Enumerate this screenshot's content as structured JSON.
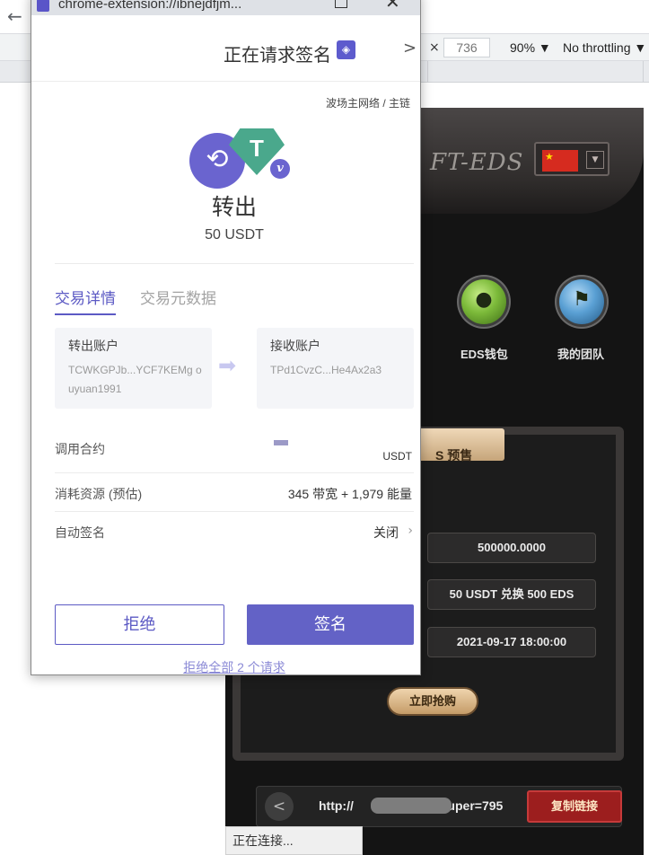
{
  "browser": {
    "back_glyph": "←",
    "devtools": {
      "close_glyph": "×",
      "height_value": "736",
      "zoom": "90% ▼",
      "throttling": "No throttling ▼"
    }
  },
  "popup": {
    "url": "chrome-extension://ibnejdfjm...",
    "restore_glyph": "",
    "close_glyph": "✕",
    "header": {
      "title": "正在请求签名",
      "logo_glyph": "◈",
      "chevron": ">"
    },
    "network": "波场主网络 / 主链",
    "transaction": {
      "icon_glyph": "⟲",
      "token_glyph": "T",
      "badge": "v",
      "operation": "转出",
      "amount": "50 USDT"
    },
    "tabs": {
      "detail": "交易详情",
      "metadata": "交易元数据"
    },
    "accounts": {
      "from_label": "转出账户",
      "from_address": "TCWKGPJb...YCF7KEMg ouyuan1991",
      "arrow_glyph": "➡",
      "to_label": "接收账户",
      "to_address": "TPd1CvzC...He4Ax2a3"
    },
    "rows": {
      "contract_label": "调用合约",
      "contract_unit": "USDT",
      "resource_label": "消耗资源 (预估)",
      "resource_value": "345 带宽 + 1,979 能量",
      "autosign_label": "自动签名",
      "autosign_value": "关闭",
      "chevron": "›"
    },
    "actions": {
      "reject": "拒绝",
      "sign": "签名",
      "reject_all": "拒绝全部 2 个请求"
    }
  },
  "game": {
    "title": "FT-EDS",
    "flag_star": "★",
    "lang_arrow": "▼",
    "wallet_glyph": "●",
    "team_glyph": "⚑",
    "wallet_label": "EDS钱包",
    "team_label": "我的团队",
    "presale_label": "S 预售",
    "total": "500000.0000",
    "rate": "50 USDT 兑换 500 EDS",
    "date": "2021-09-17 18:00:00",
    "buy_label": "立即抢购",
    "share_glyph": "<",
    "link_prefix": "http://",
    "link_suffix": "?uper=795",
    "copy_label": "复制链接"
  },
  "status": {
    "text": "正在连接..."
  }
}
